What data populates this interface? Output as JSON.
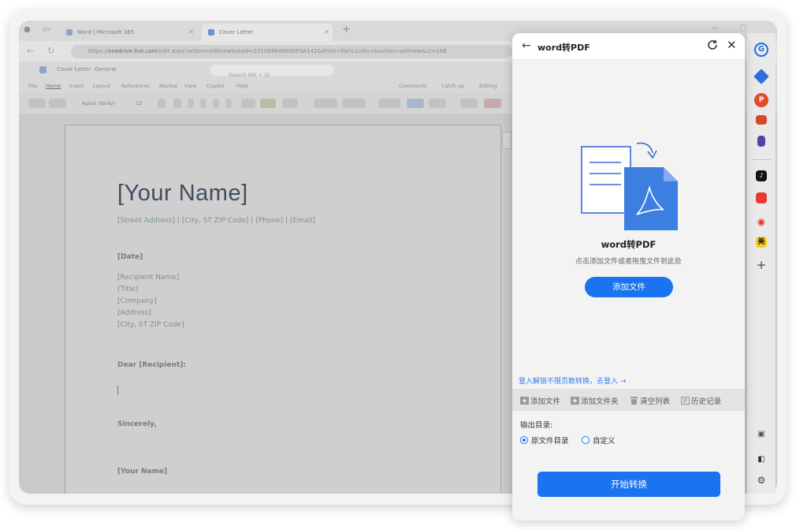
{
  "browser": {
    "tabs": [
      {
        "label": "Word | Microsoft 365"
      },
      {
        "label": "Cover Letter"
      }
    ],
    "url_host": "onedrive.live.com",
    "url_prefix": "https://",
    "url_rest": "/edit.aspx?action=editnew&resid=23108884968DF0A142&ithint=file%2cdocx&action=editnew&ct=166",
    "office": {
      "doc_title": "Cover Letter",
      "label": "General",
      "search_placeholder": "Search (Alt + Q)"
    },
    "ribbon_tabs": [
      "File",
      "Home",
      "Insert",
      "Layout",
      "References",
      "Review",
      "View",
      "Copilot",
      "Help"
    ],
    "ribbon_right": [
      "Comments",
      "Catch up",
      "Editing"
    ],
    "ribbon_font": "Aptos (Body)",
    "ribbon_size": "12"
  },
  "document": {
    "name": "[Your Name]",
    "address": "[Street Address] | [City, ST ZIP Code] | [Phone] | [Email]",
    "date": "[Date]",
    "recipient": [
      "[Recipient Name]",
      "[Title]",
      "[Company]",
      "[Address]",
      "[City, ST ZIP Code]"
    ],
    "greeting": "Dear [Recipient]:",
    "closing": "Sincerely,",
    "signature": "[Your Name]"
  },
  "panel": {
    "title": "word转PDF",
    "feature_title": "word转PDF",
    "hint": "点击添加文件或者拖曳文件到此处",
    "add_file_button": "添加文件",
    "login_link": "登入解锁不限页数转换，去登入 →",
    "toolbar": [
      "添加文件",
      "添加文件夹",
      "清空列表",
      "历史记录"
    ],
    "output_label": "输出目录:",
    "output_options": [
      {
        "label": "原文件目录",
        "selected": true
      },
      {
        "label": "自定义",
        "selected": false
      }
    ],
    "start_button": "开始转换"
  },
  "colors": {
    "accent": "#1a73f0",
    "pdf_doc": "#3d7fe0"
  }
}
